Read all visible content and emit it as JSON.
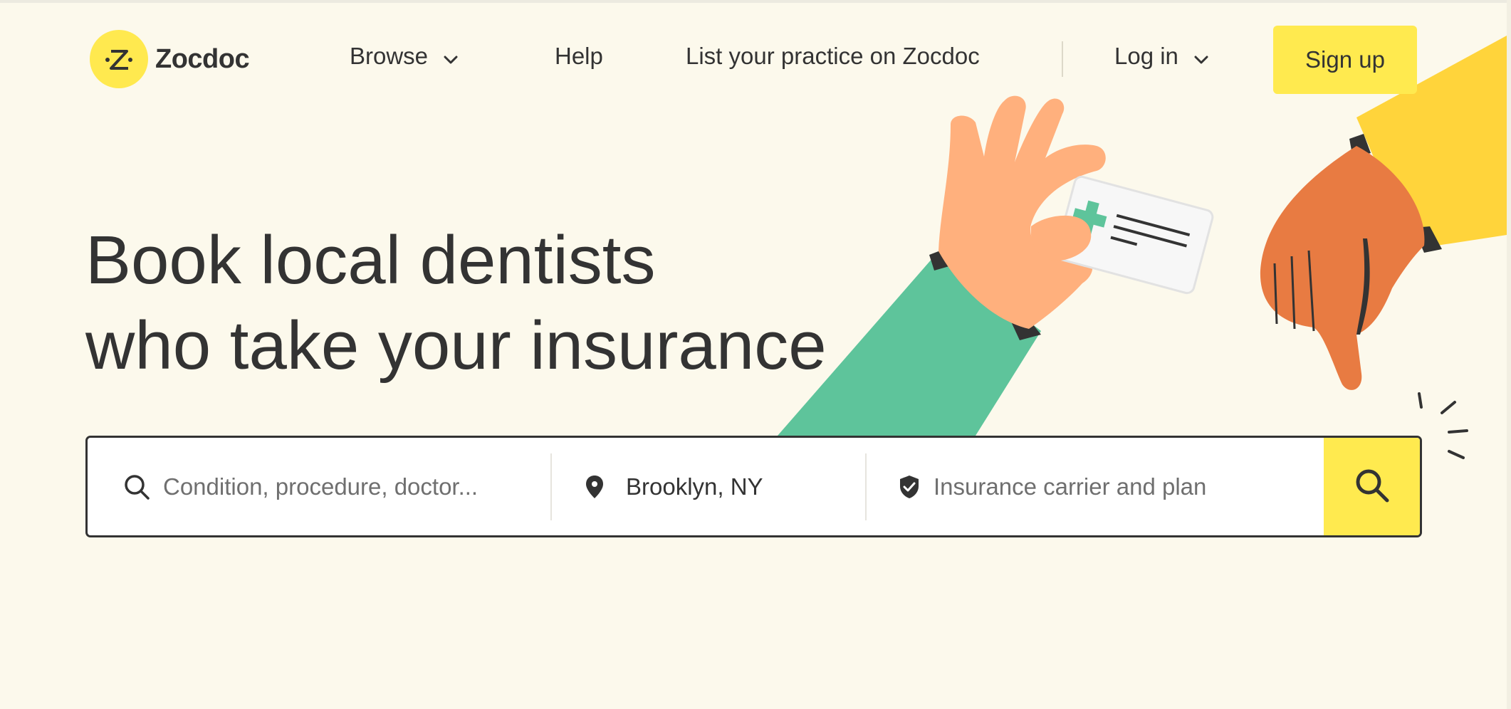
{
  "brand": {
    "name": "Zocdoc"
  },
  "nav": {
    "browse": "Browse",
    "help": "Help",
    "list_practice": "List your practice on Zocdoc",
    "login": "Log in",
    "signup": "Sign up"
  },
  "hero": {
    "line1": "Book local dentists",
    "line2": "who take your insurance"
  },
  "search": {
    "query_placeholder": "Condition, procedure, doctor...",
    "location_value": "Brooklyn, NY",
    "insurance_placeholder": "Insurance carrier and plan"
  },
  "icons": {
    "chevron": "chevron-down-icon",
    "search": "search-icon",
    "location": "location-pin-icon",
    "insurance": "shield-check-icon"
  },
  "colors": {
    "background": "#fcf9ec",
    "brand_yellow": "#ffea4f",
    "text": "#333333",
    "sleeve_green": "#5ec49b",
    "skin_light": "#ffb07d",
    "skin_dark": "#e87b42",
    "sleeve_yellow": "#ffd43b"
  }
}
